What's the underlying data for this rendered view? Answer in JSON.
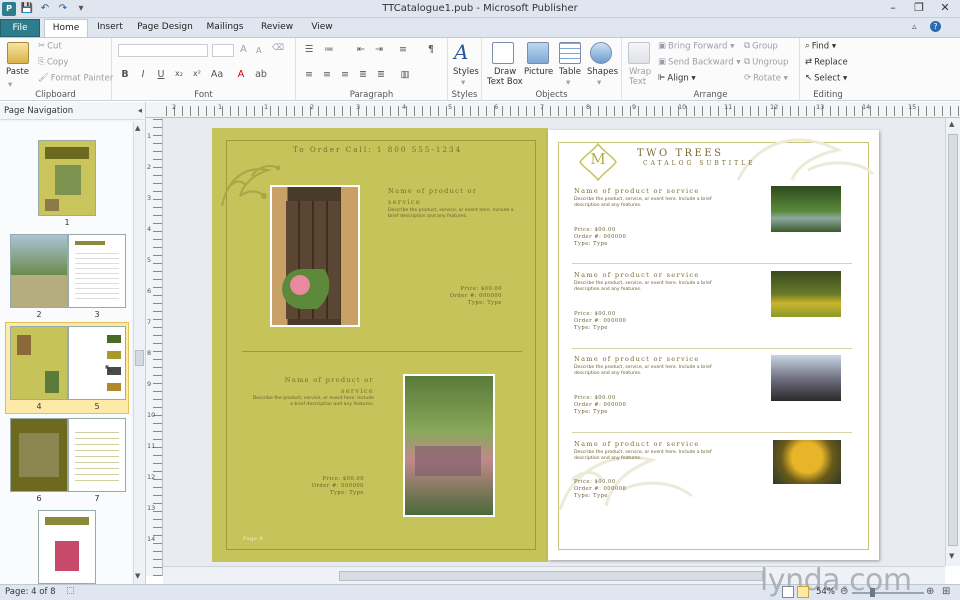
{
  "window": {
    "title": "TTCatalogue1.pub - Microsoft Publisher",
    "controls": {
      "minimize": "–",
      "restore": "❐",
      "close": "✕"
    }
  },
  "quick_access": {
    "save": "💾",
    "undo": "↶",
    "redo": "↷",
    "customize": "▾"
  },
  "tabs": [
    {
      "label": "File"
    },
    {
      "label": "Home"
    },
    {
      "label": "Insert"
    },
    {
      "label": "Page Design"
    },
    {
      "label": "Mailings"
    },
    {
      "label": "Review"
    },
    {
      "label": "View"
    }
  ],
  "ribbon": {
    "clipboard": {
      "label": "Clipboard",
      "paste": "Paste",
      "cut": "Cut",
      "copy": "Copy",
      "format_painter": "Format Painter"
    },
    "font": {
      "label": "Font",
      "bold": "B",
      "italic": "I",
      "underline": "U",
      "strikethrough": "x₂",
      "superscript": "x²",
      "size_up": "A",
      "size_down": "A"
    },
    "paragraph": {
      "label": "Paragraph"
    },
    "styles": {
      "label": "Styles",
      "button": "Styles"
    },
    "objects": {
      "label": "Objects",
      "draw_text_box_line1": "Draw",
      "draw_text_box_line2": "Text Box",
      "picture": "Picture",
      "table": "Table",
      "shapes": "Shapes"
    },
    "arrange": {
      "label": "Arrange",
      "wrap_text_line1": "Wrap",
      "wrap_text_line2": "Text",
      "bring_forward": "Bring Forward",
      "send_backward": "Send Backward",
      "align": "Align",
      "group": "Group",
      "ungroup": "Ungroup",
      "rotate": "Rotate"
    },
    "editing": {
      "label": "Editing",
      "find": "Find",
      "replace": "Replace",
      "select": "Select"
    }
  },
  "navigation": {
    "title": "Page Navigation",
    "pages": [
      {
        "label": "1",
        "selected": false
      },
      {
        "label": "2",
        "selected": false
      },
      {
        "label": "3",
        "selected": false
      },
      {
        "label": "4",
        "selected": true
      },
      {
        "label": "5",
        "selected": true
      },
      {
        "label": "6",
        "selected": false
      },
      {
        "label": "7",
        "selected": false
      }
    ]
  },
  "ruler_top": [
    "2",
    "1",
    "1",
    "2",
    "3",
    "4",
    "5",
    "6",
    "7",
    "8",
    "9",
    "10",
    "11",
    "12",
    "13",
    "14",
    "15"
  ],
  "ruler_left": [
    "1",
    "2",
    "3",
    "4",
    "5",
    "6",
    "7",
    "8",
    "9",
    "10",
    "11",
    "12",
    "13",
    "14"
  ],
  "page_left": {
    "order_line": "To Order Call: 1 800 555-1234",
    "products": [
      {
        "name": "Name of product or service",
        "desc": "Describe the product, service, or event here. Include a brief description and any features.",
        "price": "Price: $00.00",
        "order": "Order #: 000000",
        "type": "Type: Type"
      },
      {
        "name": "Name of product or service",
        "desc": "Describe the product, service, or event here. Include a brief description and any features.",
        "price": "Price: $00.00",
        "order": "Order #: 000000",
        "type": "Type: Type"
      }
    ],
    "footer": "Page 4"
  },
  "page_right": {
    "monogram": "M",
    "company": "Two Trees",
    "tagline": "Catalog Subtitle",
    "products": [
      {
        "name": "Name of product or service",
        "desc": "Describe the product, service, or event here. Include a brief description and any features.",
        "price": "Price: $00.00",
        "order": "Order #: 000000",
        "type": "Type: Type"
      },
      {
        "name": "Name of product or service",
        "desc": "Describe the product, service, or event here. Include a brief description and any features.",
        "price": "Price: $00.00",
        "order": "Order #: 000000",
        "type": "Type: Type"
      },
      {
        "name": "Name of product or service",
        "desc": "Describe the product, service, or event here. Include a brief description and any features.",
        "price": "Price: $00.00",
        "order": "Order #: 000000",
        "type": "Type: Type"
      },
      {
        "name": "Name of product or service",
        "desc": "Describe the product, service, or event here. Include a brief description and any features.",
        "price": "Price: $00.00",
        "order": "Order #: 000000",
        "type": "Type: Type"
      }
    ]
  },
  "status": {
    "page_info": "Page: 4 of 8",
    "zoom": "54%",
    "watermark": "lynda.com"
  },
  "colors": {
    "page_olive": "#c5c35a",
    "accent_text": "#7a6b2e",
    "file_tab": "#2e7d8c"
  }
}
